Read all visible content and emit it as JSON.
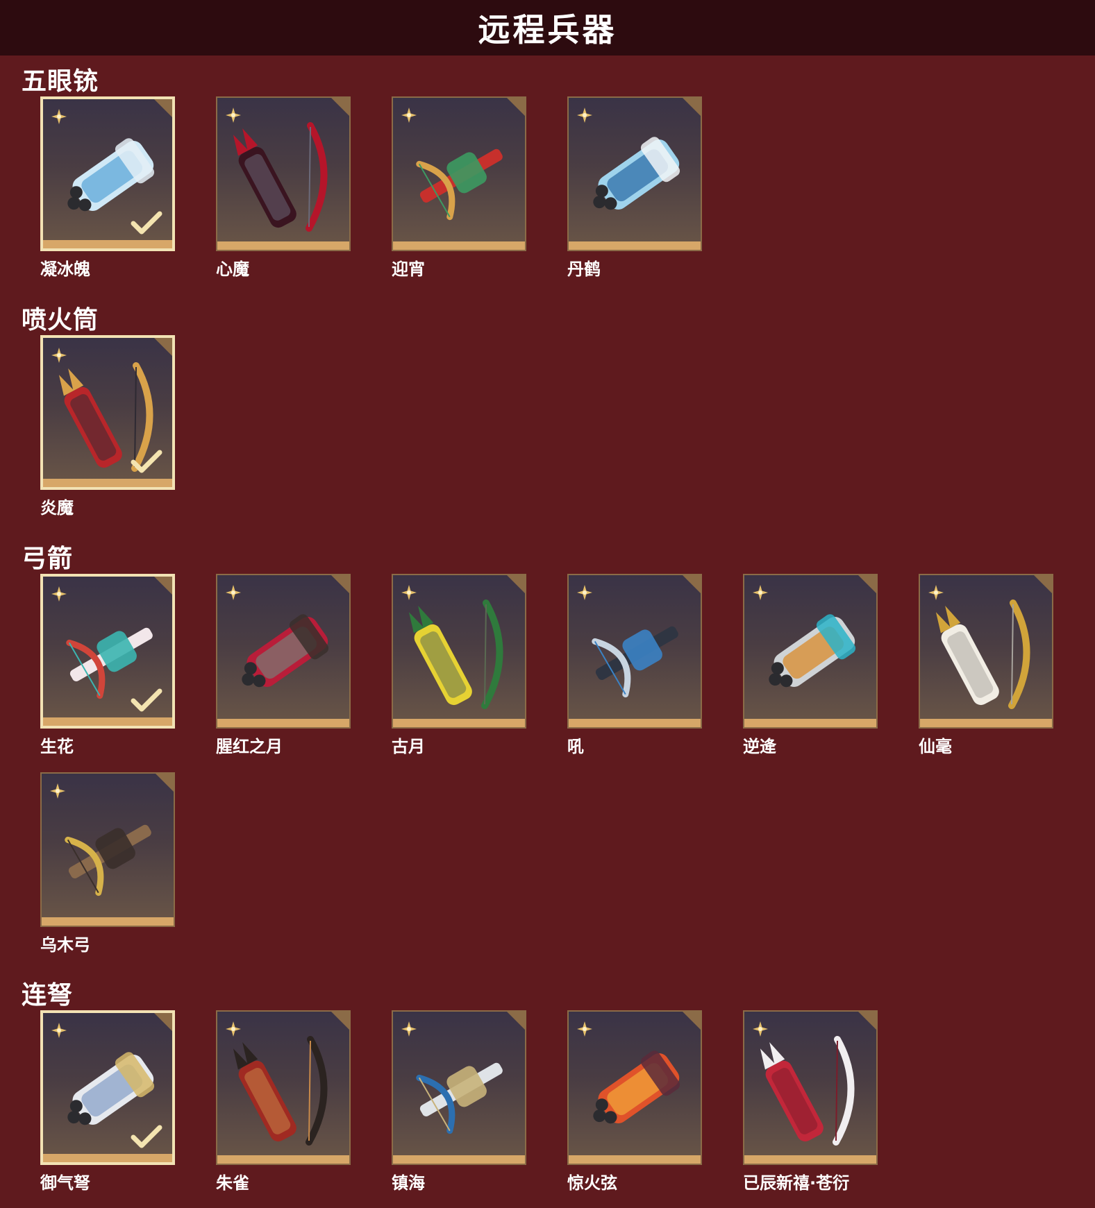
{
  "header": {
    "title": "远程兵器"
  },
  "categories": [
    {
      "title": "五眼铳",
      "items": [
        {
          "name": "凝冰魄",
          "selected": true,
          "art": [
            "#cfe8f6",
            "#5fa8d8",
            "#e4eef6"
          ]
        },
        {
          "name": "心魔",
          "selected": false,
          "art": [
            "#3a1420",
            "#b5152a",
            "#6b6a7a"
          ]
        },
        {
          "name": "迎宵",
          "selected": false,
          "art": [
            "#c7302c",
            "#d9a24a",
            "#3c9a62"
          ]
        },
        {
          "name": "丹鹤",
          "selected": false,
          "art": [
            "#9fd3ec",
            "#2f6fa8",
            "#f1f4f7"
          ]
        }
      ]
    },
    {
      "title": "喷火筒",
      "items": [
        {
          "name": "炎魔",
          "selected": true,
          "art": [
            "#b8262a",
            "#d9a24a",
            "#2e2a33"
          ]
        }
      ]
    },
    {
      "title": "弓箭",
      "items": [
        {
          "name": "生花",
          "selected": true,
          "art": [
            "#f2e7ea",
            "#d1453a",
            "#3bb5b0"
          ]
        },
        {
          "name": "腥红之月",
          "selected": false,
          "art": [
            "#b91d39",
            "#7c7572",
            "#3a2f2b"
          ]
        },
        {
          "name": "古月",
          "selected": false,
          "art": [
            "#e6d233",
            "#2f7a3c",
            "#5a6a52"
          ]
        },
        {
          "name": "吼",
          "selected": false,
          "art": [
            "#2f3542",
            "#c8d4e0",
            "#3b82c4"
          ]
        },
        {
          "name": "逆逄",
          "selected": false,
          "art": [
            "#cfd3d6",
            "#d98b2b",
            "#2db3c8"
          ]
        },
        {
          "name": "仙毫",
          "selected": false,
          "art": [
            "#f1ede4",
            "#d1a43a",
            "#a7a39c"
          ]
        },
        {
          "name": "乌木弓",
          "selected": false,
          "art": [
            "#8a6a4c",
            "#d6b24a",
            "#3a2f2b"
          ]
        }
      ]
    },
    {
      "title": "连弩",
      "items": [
        {
          "name": "御气弩",
          "selected": true,
          "art": [
            "#e6e9ee",
            "#8aa2c8",
            "#d6b86a"
          ]
        },
        {
          "name": "朱雀",
          "selected": false,
          "art": [
            "#a02a22",
            "#2b2320",
            "#c98a4a"
          ]
        },
        {
          "name": "镇海",
          "selected": false,
          "art": [
            "#dfe3e7",
            "#2c6fb0",
            "#c8b27a"
          ]
        },
        {
          "name": "惊火弦",
          "selected": false,
          "art": [
            "#e0522a",
            "#f2a33a",
            "#5a2a3a"
          ]
        },
        {
          "name": "已辰新禧·苍衍",
          "selected": false,
          "art": [
            "#c2273a",
            "#f1eef0",
            "#7c1c2a"
          ]
        }
      ]
    }
  ]
}
